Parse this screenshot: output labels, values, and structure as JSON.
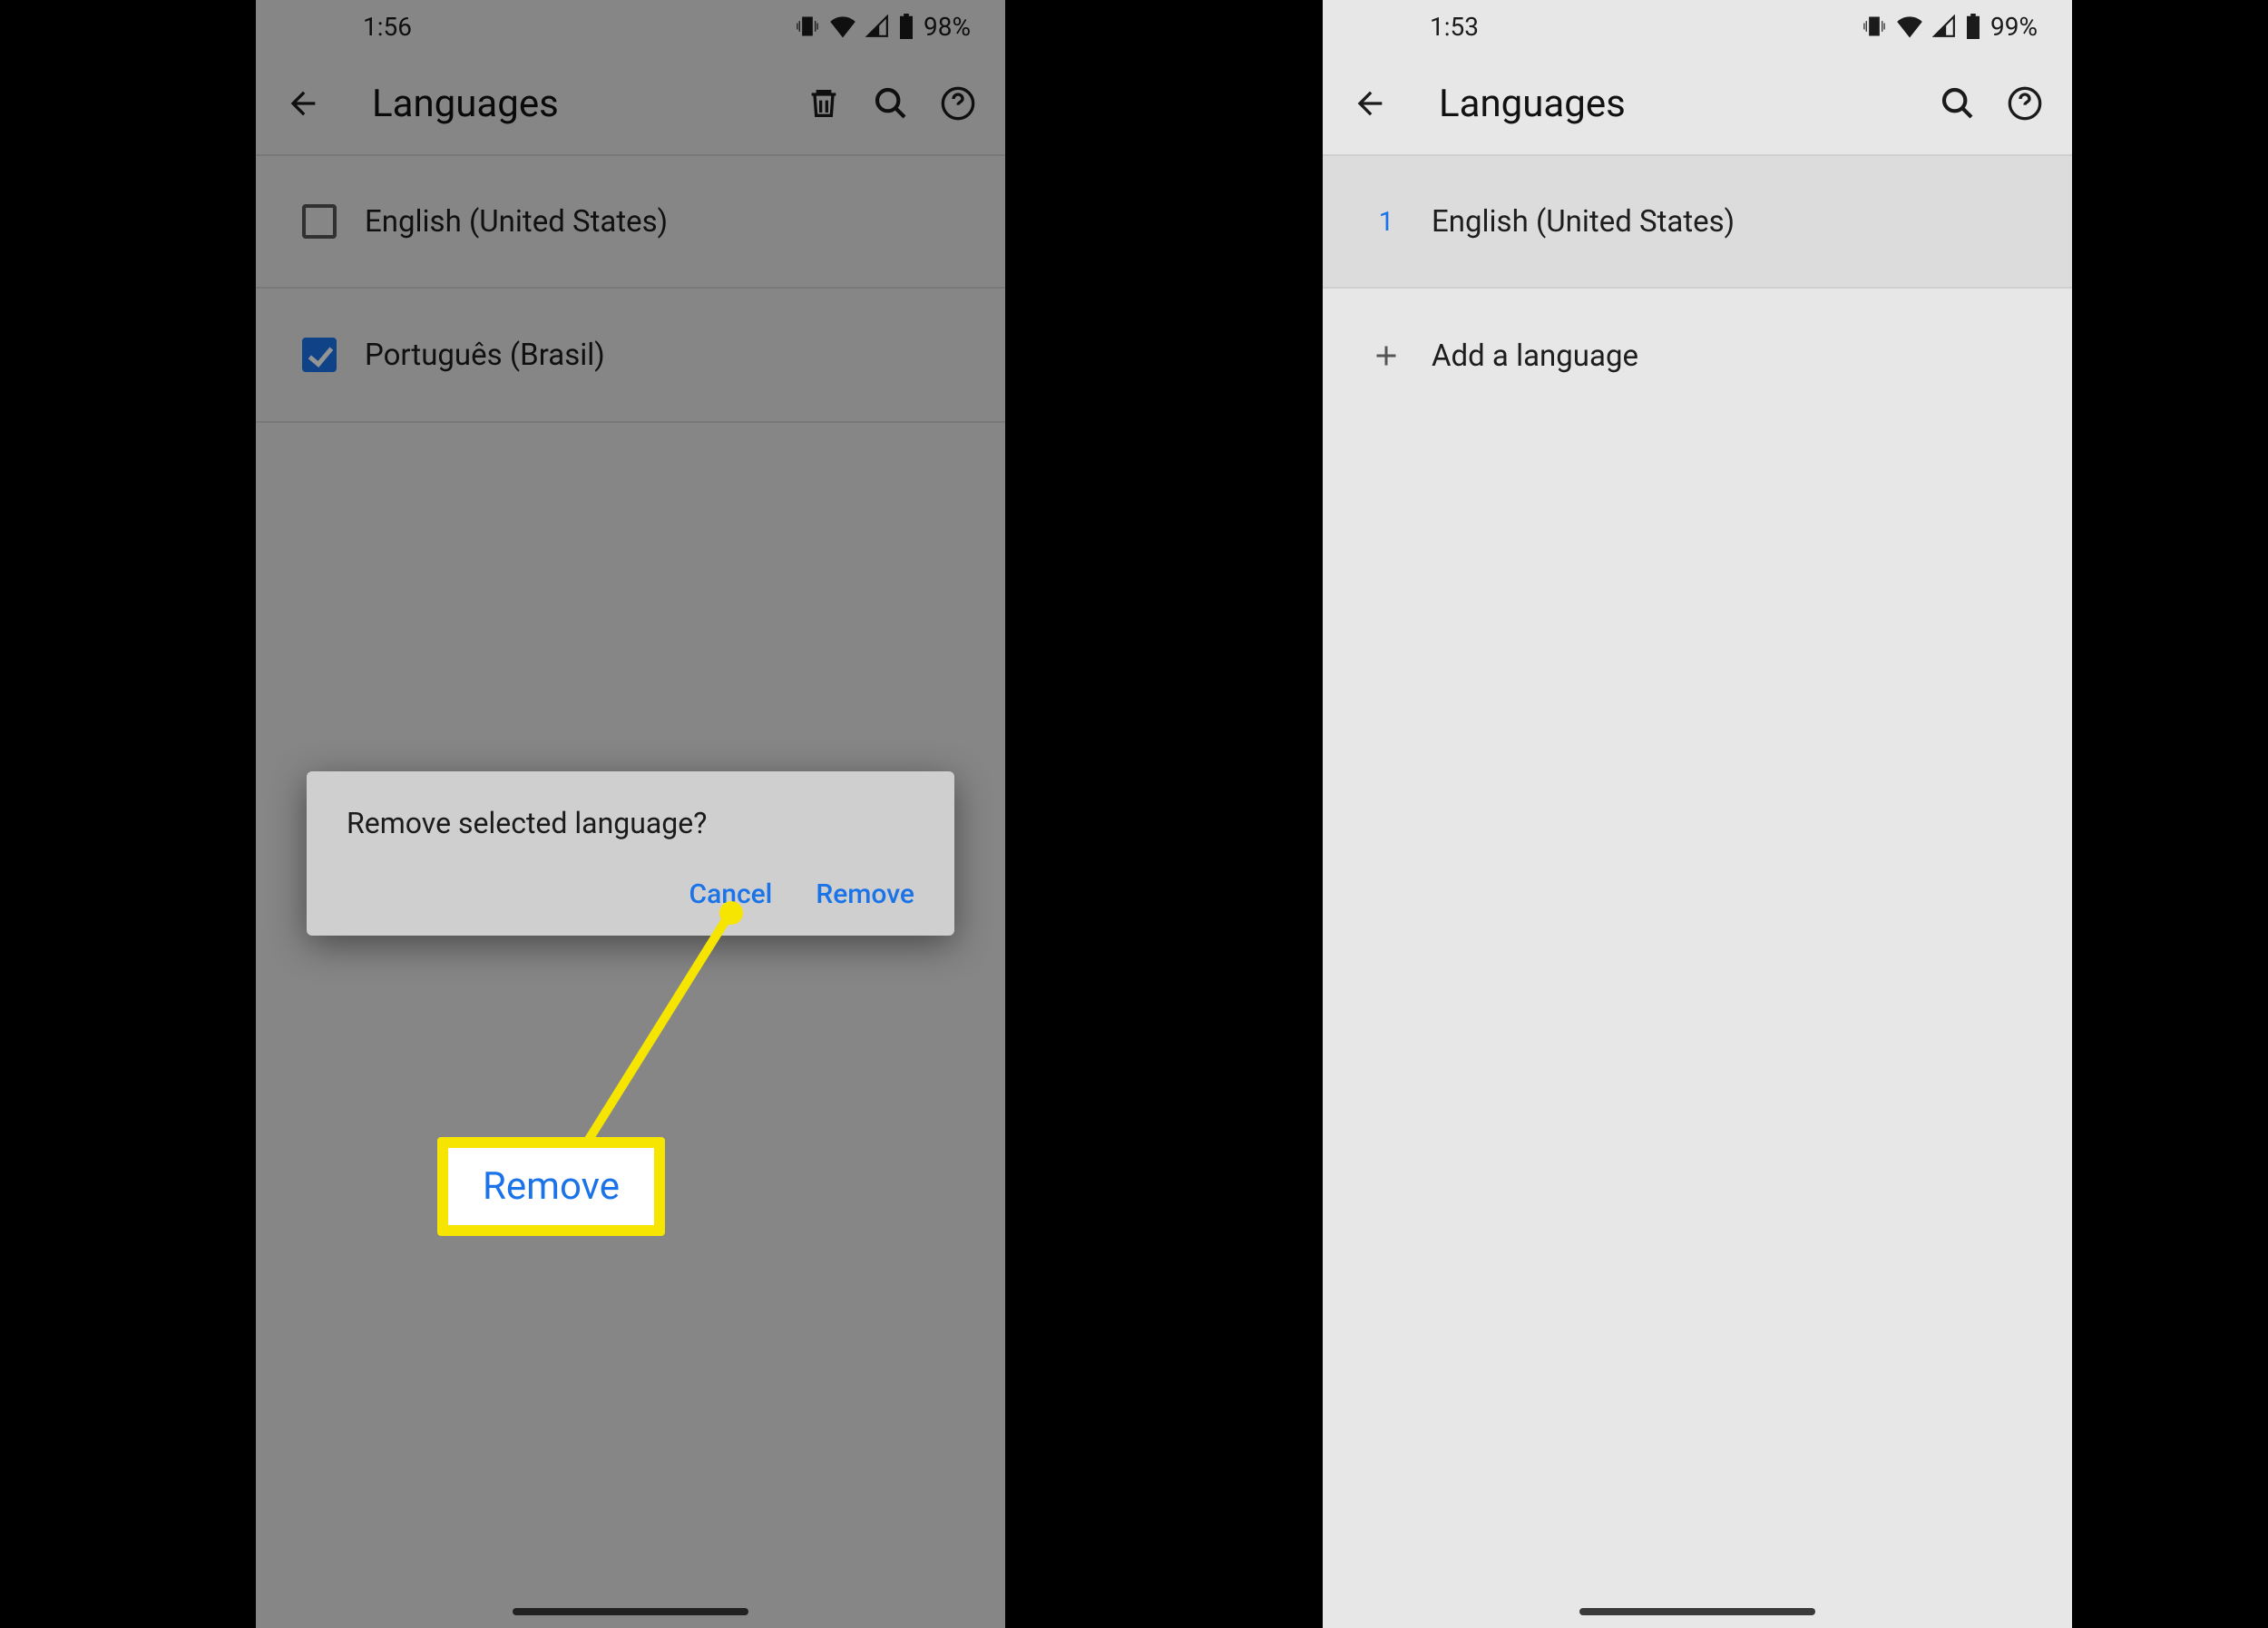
{
  "left": {
    "status": {
      "time": "1:56",
      "battery": "98%"
    },
    "appbar": {
      "title": "Languages"
    },
    "items": [
      {
        "label": "English (United States)",
        "checked": false
      },
      {
        "label": "Português (Brasil)",
        "checked": true
      }
    ],
    "dialog": {
      "title": "Remove selected language?",
      "cancel": "Cancel",
      "confirm": "Remove"
    }
  },
  "right": {
    "status": {
      "time": "1:53",
      "battery": "99%"
    },
    "appbar": {
      "title": "Languages"
    },
    "items": [
      {
        "index": "1",
        "label": "English (United States)"
      }
    ],
    "add_label": "Add a language"
  },
  "callout": {
    "label": "Remove"
  }
}
